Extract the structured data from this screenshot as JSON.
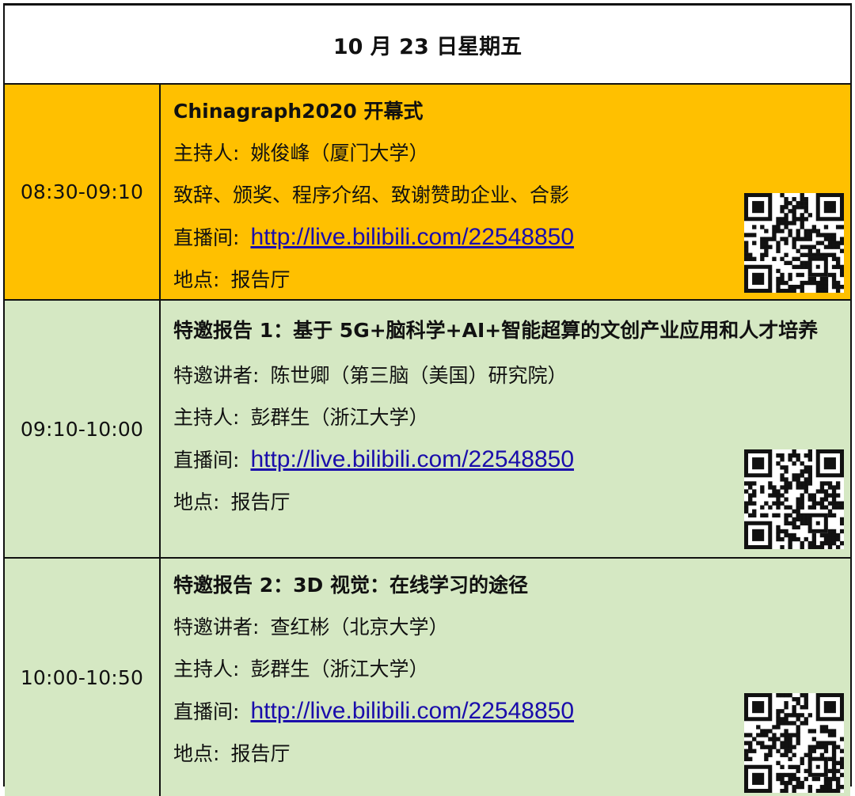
{
  "day_header": "10 月 23 日星期五",
  "sessions": [
    {
      "time": "08:30-09:10",
      "title": "Chinagraph2020 开幕式",
      "host_label": "主持人:",
      "host": "姚俊峰（厦门大学）",
      "agenda": "致辞、颁奖、程序介绍、致谢赞助企业、合影",
      "stream_label": "直播间:",
      "stream_url": "http://live.bilibili.com/22548850",
      "venue_label": "地点:",
      "venue": "报告厅",
      "background": "#ffc000"
    },
    {
      "time": "09:10-10:00",
      "title": "特邀报告 1：基于 5G+脑科学+AI+智能超算的文创产业应用和人才培养",
      "speaker_label": "特邀讲者:",
      "speaker": "陈世卿（第三脑（美国）研究院）",
      "host_label": "主持人:",
      "host": "彭群生（浙江大学）",
      "stream_label": "直播间:",
      "stream_url": "http://live.bilibili.com/22548850",
      "venue_label": "地点:",
      "venue": "报告厅",
      "background": "#d5e8c3"
    },
    {
      "time": "10:00-10:50",
      "title": "特邀报告 2：3D 视觉：在线学习的途径",
      "speaker_label": "特邀讲者:",
      "speaker": "查红彬（北京大学）",
      "host_label": "主持人:",
      "host": "彭群生（浙江大学）",
      "stream_label": "直播间:",
      "stream_url": "http://live.bilibili.com/22548850",
      "venue_label": "地点:",
      "venue": "报告厅",
      "background": "#d5e8c3"
    }
  ],
  "qr_icon": "qr-code-icon"
}
